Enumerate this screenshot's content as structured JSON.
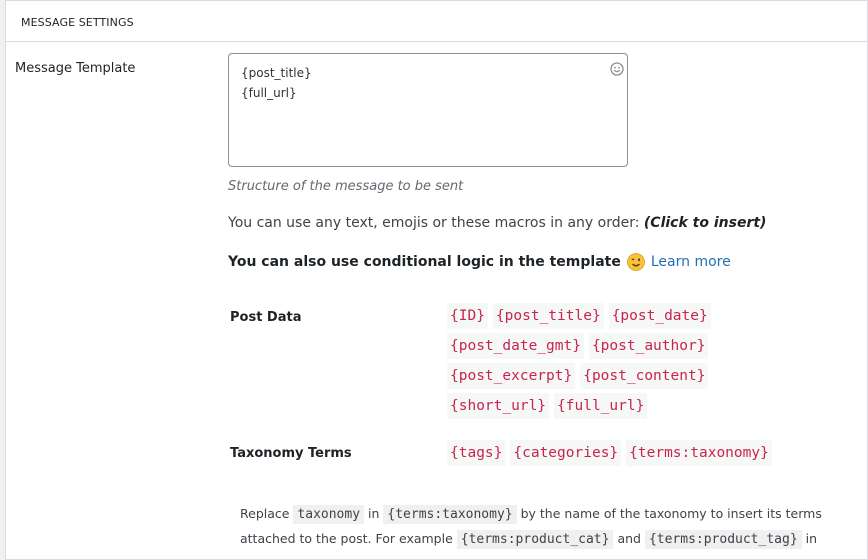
{
  "section": {
    "header": "MESSAGE SETTINGS"
  },
  "template_field": {
    "label": "Message Template",
    "value": "{post_title}\n{full_url}",
    "description": "Structure of the message to be sent"
  },
  "macros_info": {
    "intro": "You can use any text, emojis or these macros in any order: ",
    "click_hint": "(Click to insert)",
    "conditional_text": "You can also use conditional logic in the template",
    "learn_more": "Learn more"
  },
  "groups": {
    "post_data": {
      "label": "Post Data",
      "macros": [
        "{ID}",
        "{post_title}",
        "{post_date}",
        "{post_date_gmt}",
        "{post_author}",
        "{post_excerpt}",
        "{post_content}",
        "{short_url}",
        "{full_url}"
      ]
    },
    "taxonomy": {
      "label": "Taxonomy Terms",
      "macros": [
        "{tags}",
        "{categories}",
        "{terms:taxonomy}"
      ]
    }
  },
  "note": {
    "t1": "Replace ",
    "c1": "taxonomy",
    "t2": " in ",
    "c2": "{terms:taxonomy}",
    "t3": " by the name of the taxonomy to insert its terms attached to the post. For example ",
    "c3": "{terms:product_cat}",
    "t4": " and ",
    "c4": "{terms:product_tag}",
    "t5": " in"
  }
}
